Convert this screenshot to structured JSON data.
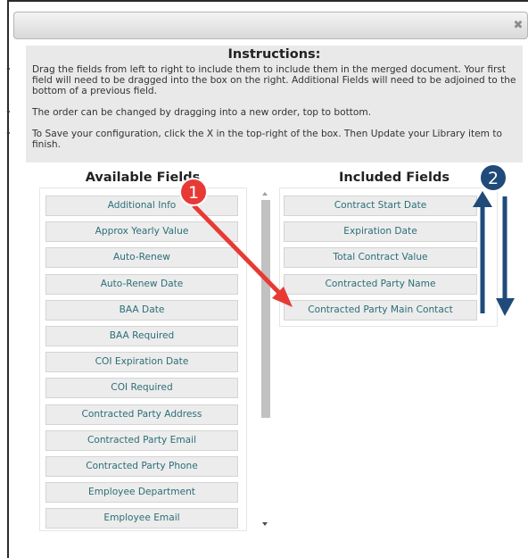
{
  "dialog": {
    "close_icon": "close-icon",
    "close_glyph": "✖"
  },
  "instructions": {
    "title": "Instructions:",
    "items": [
      "Drag the fields from left to right to include them to include them in the merged document. Your first field will need to be dragged into the box on the right. Additional Fields will need to be adjoined to the bottom of a previous field.",
      "The order can be changed by dragging into a new order, top to bottom.",
      "To Save your configuration, click the X in the top-right of the box. Then Update your Library item to finish."
    ]
  },
  "available": {
    "title": "Available Fields",
    "fields": [
      "Additional Info",
      "Approx Yearly Value",
      "Auto-Renew",
      "Auto-Renew Date",
      "BAA Date",
      "BAA Required",
      "COI Expiration Date",
      "COI Required",
      "Contracted Party Address",
      "Contracted Party Email",
      "Contracted Party Phone",
      "Employee Department",
      "Employee Email"
    ]
  },
  "included": {
    "title": "Included Fields",
    "fields": [
      "Contract Start Date",
      "Expiration Date",
      "Total Contract Value",
      "Contracted Party Name",
      "Contracted Party Main Contact"
    ]
  },
  "annotations": {
    "marker_1": "1",
    "marker_2": "2",
    "red_arrow_color": "#e83a35",
    "blue_arrow_color": "#1f4a7a"
  }
}
